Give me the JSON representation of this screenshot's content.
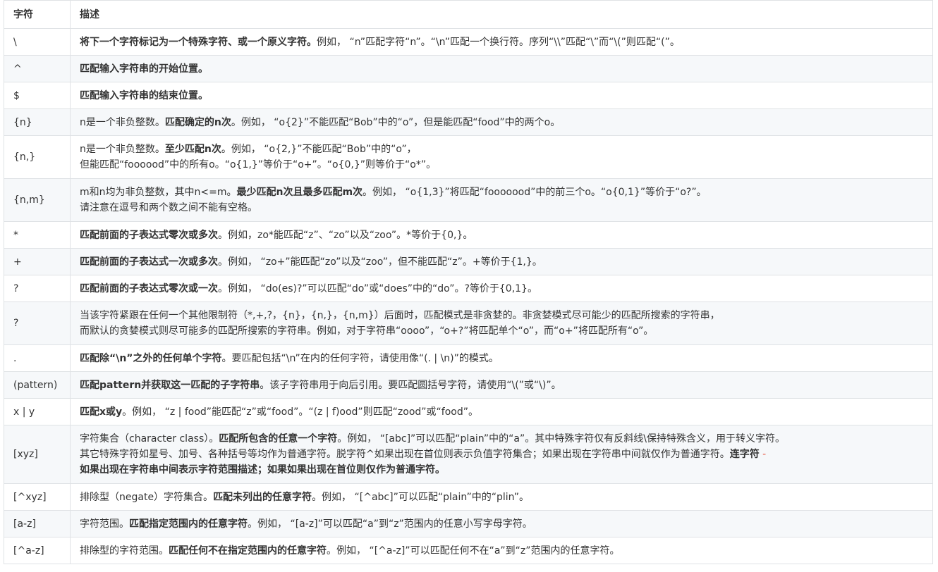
{
  "header": {
    "col_char": "字符",
    "col_desc": "描述"
  },
  "rows": [
    {
      "sym": "\\",
      "lines": [
        [
          {
            "b": true,
            "t": "将下一个字符标记为一个特殊字符、或一个原义字符。"
          },
          {
            "t": "例如， “n”匹配字符“n”。“\\n”匹配一个换行符。序列“\\\\”匹配“\\”而“\\(”则匹配“(”。"
          }
        ]
      ]
    },
    {
      "sym": "^",
      "lines": [
        [
          {
            "b": true,
            "t": "匹配输入字符串的开始位置。"
          }
        ]
      ]
    },
    {
      "sym": "$",
      "lines": [
        [
          {
            "b": true,
            "t": "匹配输入字符串的结束位置。"
          }
        ]
      ]
    },
    {
      "sym": "{n}",
      "lines": [
        [
          {
            "t": "n是一个非负整数。"
          },
          {
            "b": true,
            "t": "匹配确定的n次"
          },
          {
            "t": "。例如， “o{2}”不能匹配“Bob”中的“o”，但是能匹配“food”中的两个o。"
          }
        ]
      ]
    },
    {
      "sym": "{n,}",
      "lines": [
        [
          {
            "t": "n是一个非负整数。"
          },
          {
            "b": true,
            "t": "至少匹配n次"
          },
          {
            "t": "。例如， “o{2,}”不能匹配“Bob”中的“o”，"
          }
        ],
        [
          {
            "t": "但能匹配“foooood”中的所有o。“o{1,}”等价于“o+”。“o{0,}”则等价于“o*”。"
          }
        ]
      ]
    },
    {
      "sym": "{n,m}",
      "lines": [
        [
          {
            "t": "m和n均为非负整数，其中n<=m。"
          },
          {
            "b": true,
            "t": "最少匹配n次且最多匹配m次"
          },
          {
            "t": "。例如， “o{1,3}”将匹配“fooooood”中的前三个o。“o{0,1}”等价于“o?”。"
          }
        ],
        [
          {
            "t": "请注意在逗号和两个数之间不能有空格。"
          }
        ]
      ]
    },
    {
      "sym": "*",
      "lines": [
        [
          {
            "b": true,
            "t": "匹配前面的子表达式零次或多次"
          },
          {
            "t": "。例如，zo*能匹配“z”、“zo”以及“zoo”。*等价于{0,}。"
          }
        ]
      ]
    },
    {
      "sym": "+",
      "lines": [
        [
          {
            "b": true,
            "t": "匹配前面的子表达式一次或多次"
          },
          {
            "t": "。例如， “zo+”能匹配“zo”以及“zoo”，但不能匹配“z”。+等价于{1,}。"
          }
        ]
      ]
    },
    {
      "sym": "?",
      "lines": [
        [
          {
            "b": true,
            "t": "匹配前面的子表达式零次或一次"
          },
          {
            "t": "。例如， “do(es)?”可以匹配“do”或“does”中的“do”。?等价于{0,1}。"
          }
        ]
      ]
    },
    {
      "sym": "?",
      "lines": [
        [
          {
            "t": "当该字符紧跟在任何一个其他限制符（*,+,?，{n}，{n,}，{n,m}）后面时，匹配模式是非贪婪的。非贪婪模式尽可能少的匹配所搜索的字符串，"
          }
        ],
        [
          {
            "t": "而默认的贪婪模式则尽可能多的匹配所搜索的字符串。例如，对于字符串“oooo”，“o+?”将匹配单个“o”，而“o+”将匹配所有“o”。"
          }
        ]
      ]
    },
    {
      "sym": ".",
      "lines": [
        [
          {
            "b": true,
            "t": "匹配除“\\n”之外的任何单个字符"
          },
          {
            "t": "。要匹配包括“\\n”在内的任何字符，请使用像“(. | \\n)”的模式。"
          }
        ]
      ]
    },
    {
      "sym": "(pattern)",
      "lines": [
        [
          {
            "b": true,
            "t": "匹配pattern并获取这一匹配的子字符串"
          },
          {
            "t": "。该子字符串用于向后引用。要匹配圆括号字符，请使用“\\(”或“\\)”。"
          }
        ]
      ]
    },
    {
      "sym": "x | y",
      "lines": [
        [
          {
            "b": true,
            "t": "匹配x或y"
          },
          {
            "t": "。例如， “z | food”能匹配“z”或“food”。“(z | f)ood”则匹配“zood”或“food”。"
          }
        ]
      ]
    },
    {
      "sym": "[xyz]",
      "lines": [
        [
          {
            "t": "字符集合（character class）。"
          },
          {
            "b": true,
            "t": "匹配所包含的任意一个字符"
          },
          {
            "t": "。例如， “[abc]”可以匹配“plain”中的“a”。其中特殊字符仅有反斜线\\保持特殊含义，用于转义字符。"
          }
        ],
        [
          {
            "t": "其它特殊字符如星号、加号、各种括号等均作为普通字符。脱字符^如果出现在首位则表示负值字符集合；如果出现在字符串中间就仅作为普通字符。"
          },
          {
            "b": true,
            "t": "连字符"
          },
          {
            "t": " -",
            "red": true
          }
        ],
        [
          {
            "b": true,
            "t": "如果出现在字符串中间表示字符范围描述；如果如果出现在首位则仅作为普通字符。"
          }
        ]
      ]
    },
    {
      "sym": "[^xyz]",
      "lines": [
        [
          {
            "t": "排除型（negate）字符集合。"
          },
          {
            "b": true,
            "t": "匹配未列出的任意字符"
          },
          {
            "t": "。例如， “[^abc]”可以匹配“plain”中的“plin”。"
          }
        ]
      ]
    },
    {
      "sym": "[a-z]",
      "lines": [
        [
          {
            "t": "字符范围。"
          },
          {
            "b": true,
            "t": "匹配指定范围内的任意字符"
          },
          {
            "t": "。例如， “[a-z]”可以匹配“a”到“z”范围内的任意小写字母字符。"
          }
        ]
      ]
    },
    {
      "sym": "[^a-z]",
      "lines": [
        [
          {
            "t": "排除型的字符范围。"
          },
          {
            "b": true,
            "t": "匹配任何不在指定范围内的任意字符"
          },
          {
            "t": "。例如， “[^a-z]”可以匹配任何不在“a”到“z”范围内的任意字符。"
          }
        ]
      ]
    }
  ]
}
